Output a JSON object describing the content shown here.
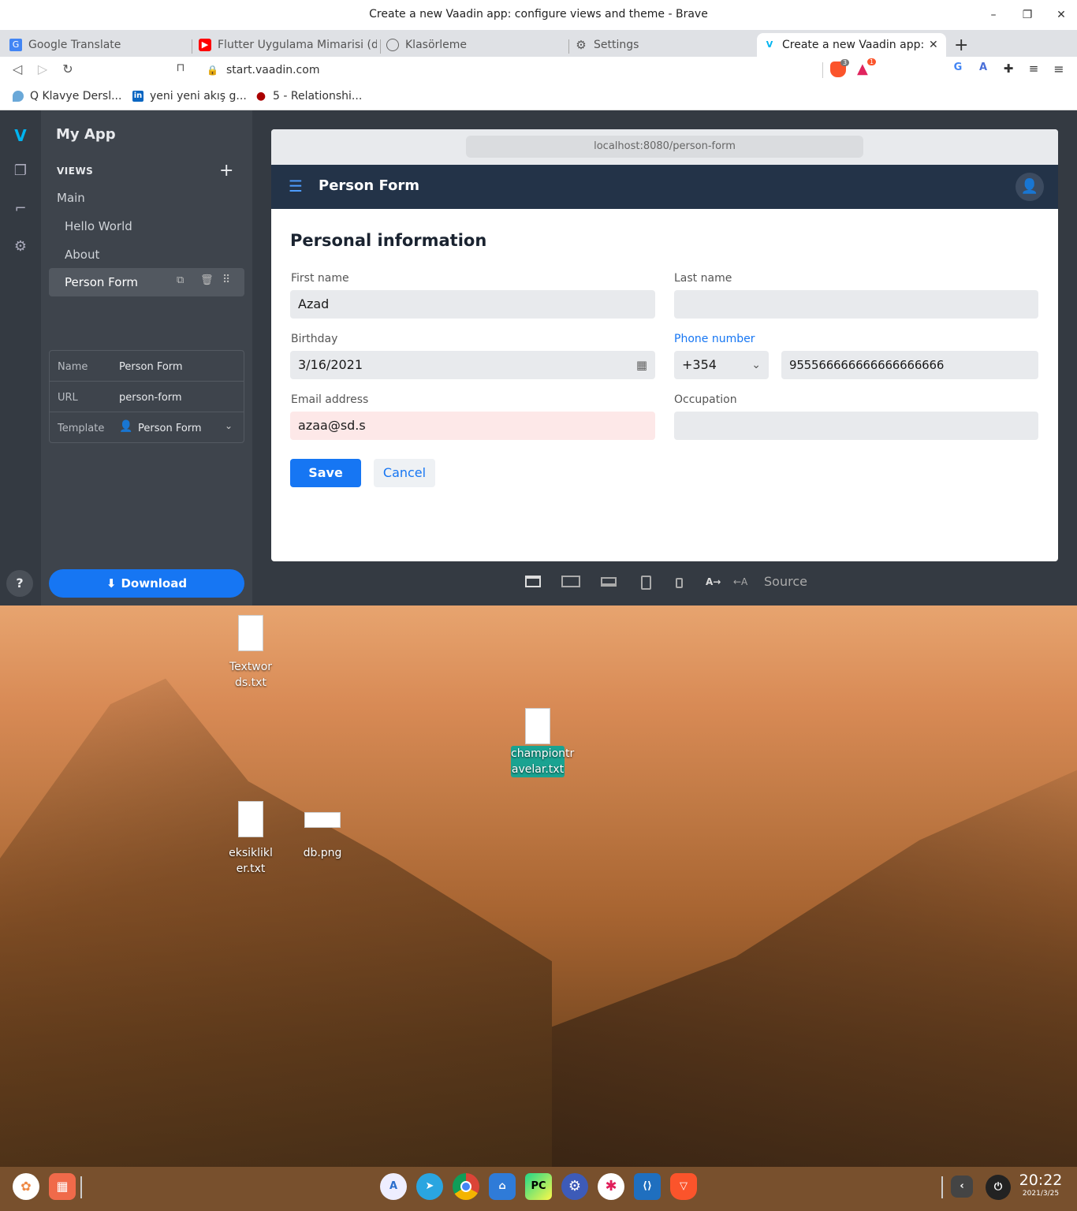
{
  "window": {
    "title": "Create a new Vaadin app: configure views and theme - Brave"
  },
  "tabs": [
    {
      "label": "Google Translate",
      "icon": "google-translate-icon"
    },
    {
      "label": "Flutter Uygulama Mimarisi (dc",
      "icon": "youtube-icon"
    },
    {
      "label": "Klasörleme",
      "icon": "globe-icon"
    },
    {
      "label": "Settings",
      "icon": "gear-icon"
    },
    {
      "label": "Create a new Vaadin app: c",
      "icon": "vaadin-icon"
    }
  ],
  "toolbar": {
    "url": "start.vaadin.com",
    "shield_count": "3",
    "rewards_count": "1"
  },
  "bookmarks": [
    {
      "label": "Q Klavye Dersl..."
    },
    {
      "label": "yeni yeni akış g..."
    },
    {
      "label": "5 - Relationshi..."
    }
  ],
  "sidebar": {
    "app_name": "My App",
    "views_heading": "VIEWS",
    "items": [
      {
        "label": "Main"
      },
      {
        "label": "Hello World"
      },
      {
        "label": "About"
      },
      {
        "label": "Person Form"
      }
    ],
    "props": [
      {
        "key": "Name",
        "value": "Person Form"
      },
      {
        "key": "URL",
        "value": "person-form"
      },
      {
        "key": "Template",
        "value": "Person Form"
      }
    ],
    "download_label": "Download",
    "help_label": "?"
  },
  "preview": {
    "address": "localhost:8080/person-form",
    "appbar_title": "Person Form",
    "heading": "Personal information",
    "fields": {
      "first_name": {
        "label": "First name",
        "value": "Azad"
      },
      "last_name": {
        "label": "Last name",
        "value": ""
      },
      "birthday": {
        "label": "Birthday",
        "value": "3/16/2021"
      },
      "phone": {
        "label": "Phone number",
        "code": "+354",
        "value": "955566666666666666666"
      },
      "email": {
        "label": "Email address",
        "value": "azaa@sd.s"
      },
      "occupation": {
        "label": "Occupation",
        "value": ""
      }
    },
    "save_label": "Save",
    "cancel_label": "Cancel",
    "source_label": "Source",
    "dir_ltr": "A→",
    "dir_rtl": "←A"
  },
  "desktop": {
    "icons": [
      {
        "label": "Textwor ds.txt"
      },
      {
        "label": "championtr avelar.txt"
      },
      {
        "label": "eksiklikl er.txt"
      },
      {
        "label": "db.png"
      }
    ]
  },
  "taskbar": {
    "time": "20:22",
    "date": "2021/3/25"
  },
  "colors": {
    "accent": "#1676f3",
    "appbar": "#233348",
    "error_bg": "#fde8e8"
  }
}
